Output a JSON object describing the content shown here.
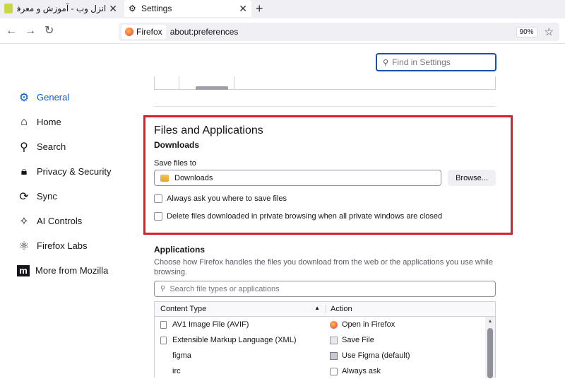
{
  "tabs": [
    {
      "title": "انزل وب - آموزش و معرفی فناوری",
      "close": "✕"
    },
    {
      "title": "Settings",
      "close": "✕"
    }
  ],
  "newtab": "+",
  "nav": {
    "back": "←",
    "forward": "→",
    "reload": "↻"
  },
  "urlbar": {
    "identity": "Firefox",
    "url": "about:preferences",
    "zoom": "90%"
  },
  "find": {
    "placeholder": "Find in Settings"
  },
  "sidebar": {
    "items": [
      {
        "label": "General",
        "icon": "gear-icon",
        "glyph": "⚙",
        "active": true
      },
      {
        "label": "Home",
        "icon": "home-icon",
        "glyph": "⌂"
      },
      {
        "label": "Search",
        "icon": "search-icon",
        "glyph": "⚲"
      },
      {
        "label": "Privacy & Security",
        "icon": "lock-icon",
        "glyph": "🔒︎"
      },
      {
        "label": "Sync",
        "icon": "sync-icon",
        "glyph": "⟳"
      },
      {
        "label": "AI Controls",
        "icon": "sparkle-icon",
        "glyph": "✧"
      },
      {
        "label": "Firefox Labs",
        "icon": "atom-icon",
        "glyph": "⚛"
      },
      {
        "label": "More from Mozilla",
        "icon": "mozilla-icon",
        "glyph": "m"
      }
    ]
  },
  "files": {
    "heading": "Files and Applications",
    "downloads_heading": "Downloads",
    "save_label": "Save files to",
    "save_path": "Downloads",
    "browse": "Browse...",
    "always_ask": "Always ask you where to save files",
    "delete_private": "Delete files downloaded in private browsing when all private windows are closed"
  },
  "applications": {
    "heading": "Applications",
    "description": "Choose how Firefox handles the files you download from the web or the applications you use while browsing.",
    "search_placeholder": "Search file types or applications",
    "col_content": "Content Type",
    "col_action": "Action",
    "sort_glyph": "▲",
    "rows": [
      {
        "type": "AV1 Image File (AVIF)",
        "action": "Open in Firefox",
        "action_icon": "ff"
      },
      {
        "type": "Extensible Markup Language (XML)",
        "action": "Save File",
        "action_icon": "save"
      },
      {
        "type": "figma",
        "action": "Use Figma (default)",
        "action_icon": "figma"
      },
      {
        "type": "irc",
        "action": "Always ask",
        "action_icon": "ask"
      }
    ]
  },
  "colors": {
    "accent": "#0061e0",
    "highlight": "#d6202c",
    "focus": "#1c4fa5"
  }
}
